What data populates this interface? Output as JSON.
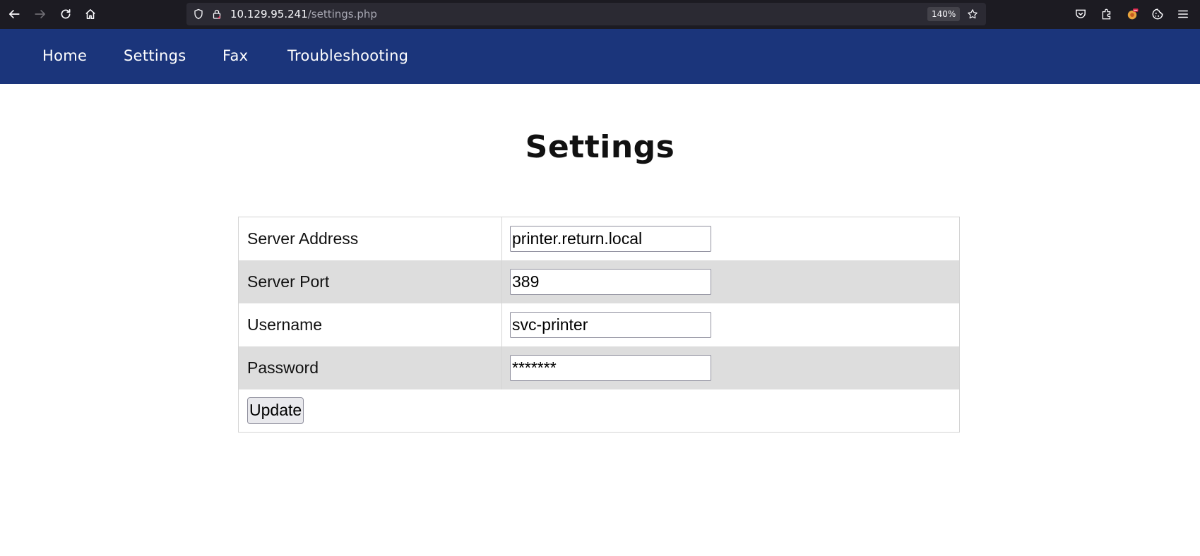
{
  "browser": {
    "url_host": "10.129.95.241",
    "url_path": "/settings.php",
    "zoom": "140%",
    "icons": [
      "back-icon",
      "forward-icon",
      "reload-icon",
      "home-icon",
      "shield-icon",
      "lock-icon",
      "bookmark-star-icon",
      "pocket-icon",
      "extensions-icon",
      "profile-icon",
      "cookie-icon",
      "menu-icon"
    ]
  },
  "nav": {
    "items": [
      {
        "label": "Home"
      },
      {
        "label": "Settings"
      },
      {
        "label": "Fax"
      },
      {
        "label": "Troubleshooting"
      }
    ]
  },
  "page": {
    "title": "Settings"
  },
  "form": {
    "rows": [
      {
        "label": "Server Address",
        "value": "printer.return.local"
      },
      {
        "label": "Server Port",
        "value": "389"
      },
      {
        "label": "Username",
        "value": "svc-printer"
      },
      {
        "label": "Password",
        "value": "*******"
      }
    ],
    "submit_label": "Update"
  },
  "colors": {
    "nav_background": "#1b357b",
    "alt_row_background": "#dddddd",
    "browser_toolbar": "#1c1b22"
  }
}
